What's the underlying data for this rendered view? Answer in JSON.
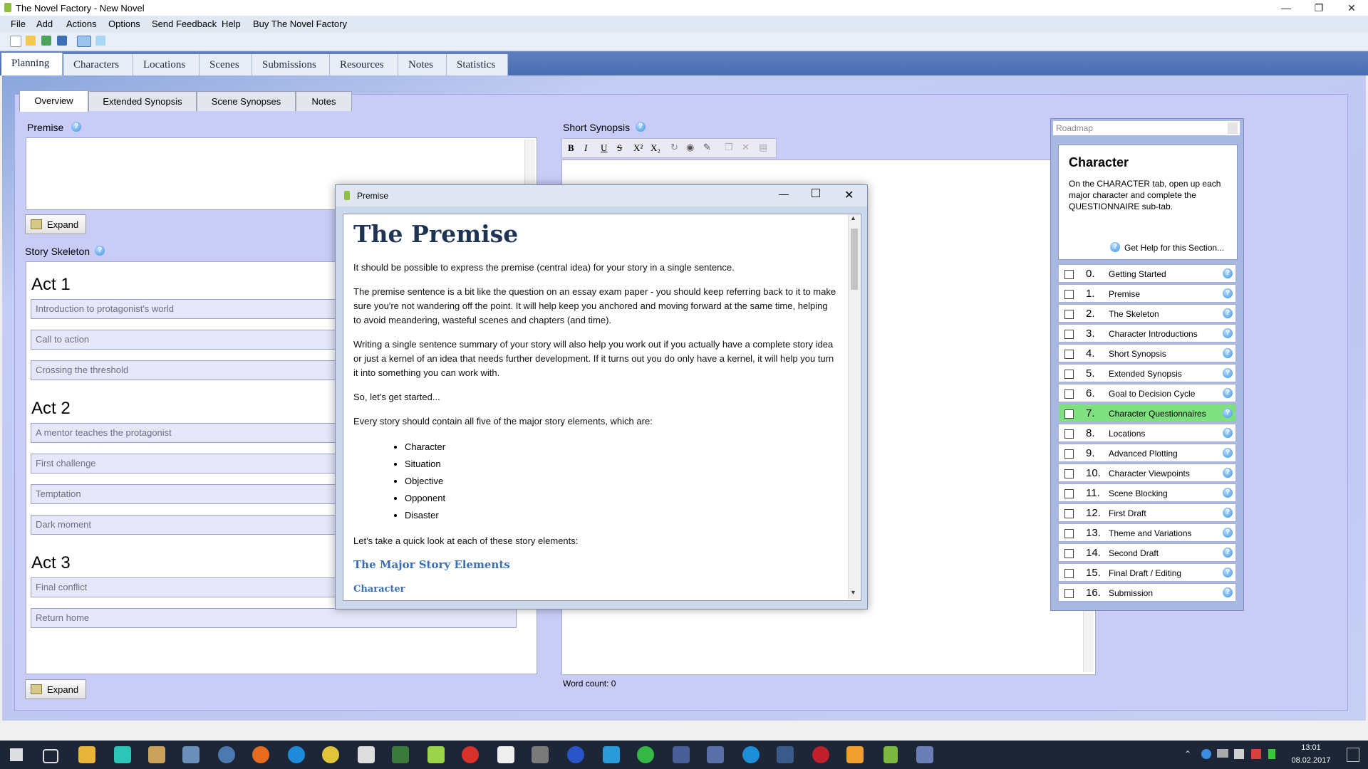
{
  "window": {
    "title": "The Novel Factory - New Novel"
  },
  "menu": [
    "File",
    "Add",
    "Actions",
    "Options",
    "Send Feedback",
    "Help",
    "Buy The Novel Factory"
  ],
  "main_tabs": [
    "Planning",
    "Characters",
    "Locations",
    "Scenes",
    "Submissions",
    "Resources",
    "Notes",
    "Statistics"
  ],
  "sub_tabs": [
    "Overview",
    "Extended Synopsis",
    "Scene Synopses",
    "Notes"
  ],
  "premise": {
    "label": "Premise",
    "expand": "Expand"
  },
  "skeleton": {
    "label": "Story Skeleton",
    "expand": "Expand",
    "acts": [
      {
        "title": "Act 1",
        "beats": [
          "Introduction to protagonist's world",
          "Call to action",
          "Crossing the threshold"
        ]
      },
      {
        "title": "Act 2",
        "beats": [
          "A mentor teaches the protagonist",
          "First challenge",
          "Temptation",
          "Dark moment"
        ]
      },
      {
        "title": "Act 3",
        "beats": [
          "Final conflict",
          "Return home"
        ]
      }
    ]
  },
  "synopsis": {
    "label": "Short Synopsis",
    "word_count": "Word count: 0"
  },
  "dialog": {
    "title": "Premise",
    "heading": "The Premise",
    "p1": "It should be possible to express the premise (central idea) for your story in a single sentence.",
    "p2": "The premise sentence is a bit like the question on an essay exam paper - you should keep referring back to it to make sure you're not wandering off the point. It will help keep you anchored and moving forward at the same time, helping to avoid meandering, wasteful scenes and chapters (and time).",
    "p3": "Writing a single sentence summary of your story will also help you work out if you actually have a complete story idea or just a kernel of an idea that needs further development. If it turns out you do only have a kernel, it will help you turn it into something you can work with.",
    "p4": "So, let's get started...",
    "p5": "Every story should contain all five of the major story elements, which are:",
    "elements": [
      "Character",
      "Situation",
      "Objective",
      "Opponent",
      "Disaster"
    ],
    "p6": "Let's take a quick look at each of these story elements:",
    "subheading": "The Major Story Elements",
    "cut_text": "Character"
  },
  "roadmap": {
    "title": "Roadmap",
    "section_title": "Character",
    "section_text": "On the CHARACTER tab, open up each major character and complete the QUESTIONNAIRE sub-tab.",
    "help_link": "Get Help for this Section...",
    "items": [
      {
        "num": "0.",
        "name": "Getting Started"
      },
      {
        "num": "1.",
        "name": "Premise"
      },
      {
        "num": "2.",
        "name": "The Skeleton"
      },
      {
        "num": "3.",
        "name": "Character Introductions"
      },
      {
        "num": "4.",
        "name": "Short Synopsis"
      },
      {
        "num": "5.",
        "name": "Extended Synopsis"
      },
      {
        "num": "6.",
        "name": "Goal to Decision Cycle"
      },
      {
        "num": "7.",
        "name": "Character Questionnaires"
      },
      {
        "num": "8.",
        "name": "Locations"
      },
      {
        "num": "9.",
        "name": "Advanced Plotting"
      },
      {
        "num": "10.",
        "name": "Character Viewpoints"
      },
      {
        "num": "11.",
        "name": "Scene Blocking"
      },
      {
        "num": "12.",
        "name": "First Draft"
      },
      {
        "num": "13.",
        "name": "Theme and Variations"
      },
      {
        "num": "14.",
        "name": "Second Draft"
      },
      {
        "num": "15.",
        "name": "Final Draft / Editing"
      },
      {
        "num": "16.",
        "name": "Submission"
      }
    ],
    "highlight_color": "#7ee07e"
  },
  "taskbar": {
    "time": "13:01",
    "date": "08.02.2017"
  }
}
